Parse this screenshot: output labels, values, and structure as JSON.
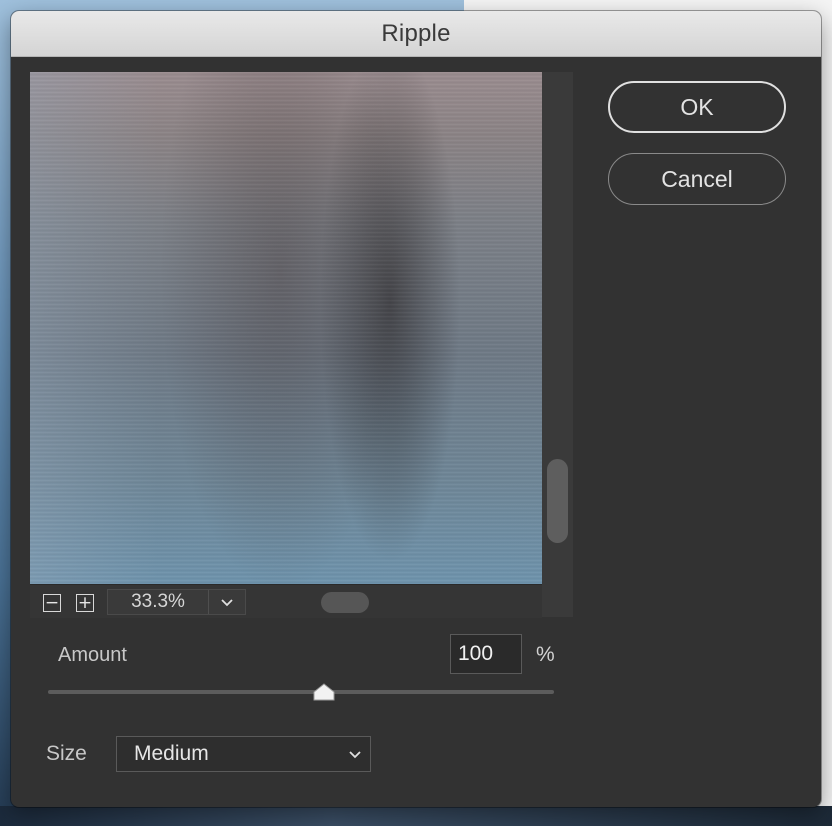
{
  "dialog": {
    "title": "Ripple"
  },
  "preview": {
    "zoom_out_glyph": "−",
    "zoom_in_glyph": "+",
    "zoom_level": "33.3%",
    "zoom_dropdown_icon": "chevron-down-icon"
  },
  "buttons": {
    "ok_label": "OK",
    "cancel_label": "Cancel"
  },
  "amount": {
    "label": "Amount",
    "value": "100",
    "unit": "%",
    "slider_position": 0.545
  },
  "size": {
    "label": "Size",
    "selected": "Medium",
    "dropdown_icon": "chevron-down-icon"
  },
  "colors": {
    "dialog_background": "#323232",
    "titlebar": "#d9d9d9",
    "text": "#e3e3e3"
  }
}
